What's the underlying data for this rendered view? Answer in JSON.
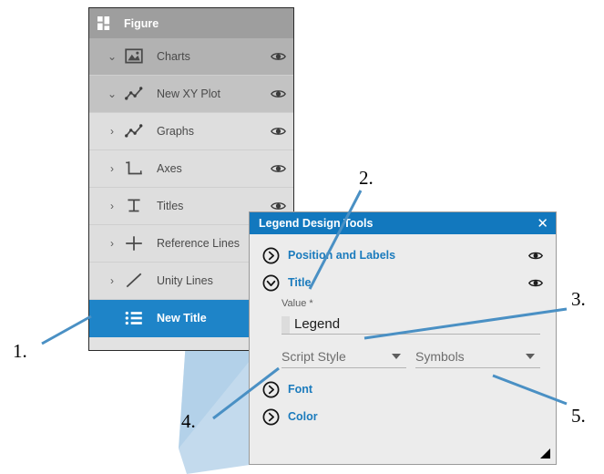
{
  "tree": {
    "header": {
      "title": "Figure",
      "icon": "grid-squares-icon"
    },
    "rows": [
      {
        "label": "Charts",
        "twisty": "⌄",
        "expanded": true,
        "icon": "image-chart-icon",
        "eye": "eye-icon",
        "level": 1
      },
      {
        "label": "New XY Plot",
        "twisty": "⌄",
        "expanded": true,
        "icon": "xy-plot-icon",
        "eye": "eye-icon",
        "level": 2
      },
      {
        "label": "Graphs",
        "twisty": "›",
        "expanded": false,
        "icon": "xy-plot-icon",
        "eye": "eye-icon",
        "level": 3
      },
      {
        "label": "Axes",
        "twisty": "›",
        "expanded": false,
        "icon": "axes-icon",
        "eye": "eye-icon",
        "level": 3
      },
      {
        "label": "Titles",
        "twisty": "›",
        "expanded": false,
        "icon": "title-t-icon",
        "eye": "eye-icon",
        "level": 3
      },
      {
        "label": "Reference Lines",
        "twisty": "›",
        "expanded": false,
        "icon": "reference-line-icon",
        "eye": "eye-icon",
        "level": 3
      },
      {
        "label": "Unity Lines",
        "twisty": "›",
        "expanded": false,
        "icon": "unity-line-icon",
        "eye": "eye-icon",
        "level": 3
      },
      {
        "label": "New Title",
        "twisty": "",
        "expanded": false,
        "icon": "list-lines-icon",
        "eye": "",
        "level": 4,
        "selected": true
      }
    ]
  },
  "dialog": {
    "title": "Legend Design Tools",
    "close_icon": "close-icon",
    "sections": [
      {
        "label": "Position and Labels",
        "chevron": "chevron-right-icon",
        "expanded": false,
        "eye": "eye-icon"
      },
      {
        "label": "Title",
        "chevron": "chevron-down-icon",
        "expanded": true,
        "eye": "eye-icon"
      }
    ],
    "value_field": {
      "caption": "Value *",
      "value": "Legend"
    },
    "dropdowns": [
      {
        "label": "Script Style",
        "arrow": "chevron-down-icon"
      },
      {
        "label": "Symbols",
        "arrow": "chevron-down-icon"
      }
    ],
    "lower_sections": [
      {
        "label": "Font",
        "chevron": "chevron-right-icon"
      },
      {
        "label": "Color",
        "chevron": "chevron-right-icon"
      }
    ],
    "resize_grip": "resize-grip-icon"
  },
  "callouts": [
    {
      "number": "1."
    },
    {
      "number": "2."
    },
    {
      "number": "3."
    },
    {
      "number": "4."
    },
    {
      "number": "5."
    }
  ],
  "colors": {
    "accent": "#1278be",
    "selection": "#1e84c8",
    "link": "#1b7bbd",
    "leader": "#4a90c4",
    "spotlight": "#b8d4ea",
    "panel_header": "#9e9e9e",
    "dialog_bg": "#ececec"
  }
}
